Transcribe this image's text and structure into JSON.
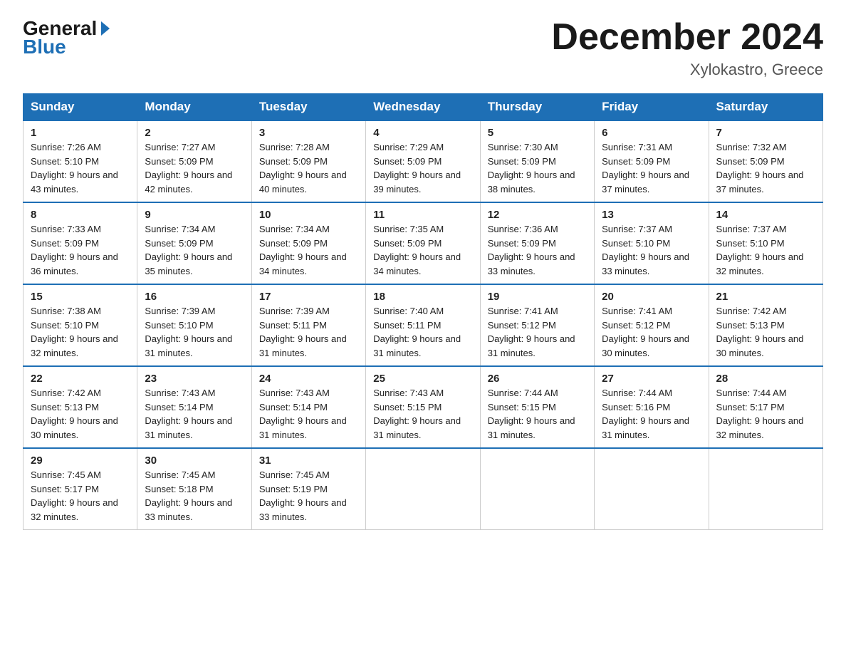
{
  "header": {
    "logo_general": "General",
    "logo_blue": "Blue",
    "month_title": "December 2024",
    "location": "Xylokastro, Greece"
  },
  "columns": [
    "Sunday",
    "Monday",
    "Tuesday",
    "Wednesday",
    "Thursday",
    "Friday",
    "Saturday"
  ],
  "weeks": [
    [
      {
        "day": "1",
        "sunrise": "7:26 AM",
        "sunset": "5:10 PM",
        "daylight": "9 hours and 43 minutes."
      },
      {
        "day": "2",
        "sunrise": "7:27 AM",
        "sunset": "5:09 PM",
        "daylight": "9 hours and 42 minutes."
      },
      {
        "day": "3",
        "sunrise": "7:28 AM",
        "sunset": "5:09 PM",
        "daylight": "9 hours and 40 minutes."
      },
      {
        "day": "4",
        "sunrise": "7:29 AM",
        "sunset": "5:09 PM",
        "daylight": "9 hours and 39 minutes."
      },
      {
        "day": "5",
        "sunrise": "7:30 AM",
        "sunset": "5:09 PM",
        "daylight": "9 hours and 38 minutes."
      },
      {
        "day": "6",
        "sunrise": "7:31 AM",
        "sunset": "5:09 PM",
        "daylight": "9 hours and 37 minutes."
      },
      {
        "day": "7",
        "sunrise": "7:32 AM",
        "sunset": "5:09 PM",
        "daylight": "9 hours and 37 minutes."
      }
    ],
    [
      {
        "day": "8",
        "sunrise": "7:33 AM",
        "sunset": "5:09 PM",
        "daylight": "9 hours and 36 minutes."
      },
      {
        "day": "9",
        "sunrise": "7:34 AM",
        "sunset": "5:09 PM",
        "daylight": "9 hours and 35 minutes."
      },
      {
        "day": "10",
        "sunrise": "7:34 AM",
        "sunset": "5:09 PM",
        "daylight": "9 hours and 34 minutes."
      },
      {
        "day": "11",
        "sunrise": "7:35 AM",
        "sunset": "5:09 PM",
        "daylight": "9 hours and 34 minutes."
      },
      {
        "day": "12",
        "sunrise": "7:36 AM",
        "sunset": "5:09 PM",
        "daylight": "9 hours and 33 minutes."
      },
      {
        "day": "13",
        "sunrise": "7:37 AM",
        "sunset": "5:10 PM",
        "daylight": "9 hours and 33 minutes."
      },
      {
        "day": "14",
        "sunrise": "7:37 AM",
        "sunset": "5:10 PM",
        "daylight": "9 hours and 32 minutes."
      }
    ],
    [
      {
        "day": "15",
        "sunrise": "7:38 AM",
        "sunset": "5:10 PM",
        "daylight": "9 hours and 32 minutes."
      },
      {
        "day": "16",
        "sunrise": "7:39 AM",
        "sunset": "5:10 PM",
        "daylight": "9 hours and 31 minutes."
      },
      {
        "day": "17",
        "sunrise": "7:39 AM",
        "sunset": "5:11 PM",
        "daylight": "9 hours and 31 minutes."
      },
      {
        "day": "18",
        "sunrise": "7:40 AM",
        "sunset": "5:11 PM",
        "daylight": "9 hours and 31 minutes."
      },
      {
        "day": "19",
        "sunrise": "7:41 AM",
        "sunset": "5:12 PM",
        "daylight": "9 hours and 31 minutes."
      },
      {
        "day": "20",
        "sunrise": "7:41 AM",
        "sunset": "5:12 PM",
        "daylight": "9 hours and 30 minutes."
      },
      {
        "day": "21",
        "sunrise": "7:42 AM",
        "sunset": "5:13 PM",
        "daylight": "9 hours and 30 minutes."
      }
    ],
    [
      {
        "day": "22",
        "sunrise": "7:42 AM",
        "sunset": "5:13 PM",
        "daylight": "9 hours and 30 minutes."
      },
      {
        "day": "23",
        "sunrise": "7:43 AM",
        "sunset": "5:14 PM",
        "daylight": "9 hours and 31 minutes."
      },
      {
        "day": "24",
        "sunrise": "7:43 AM",
        "sunset": "5:14 PM",
        "daylight": "9 hours and 31 minutes."
      },
      {
        "day": "25",
        "sunrise": "7:43 AM",
        "sunset": "5:15 PM",
        "daylight": "9 hours and 31 minutes."
      },
      {
        "day": "26",
        "sunrise": "7:44 AM",
        "sunset": "5:15 PM",
        "daylight": "9 hours and 31 minutes."
      },
      {
        "day": "27",
        "sunrise": "7:44 AM",
        "sunset": "5:16 PM",
        "daylight": "9 hours and 31 minutes."
      },
      {
        "day": "28",
        "sunrise": "7:44 AM",
        "sunset": "5:17 PM",
        "daylight": "9 hours and 32 minutes."
      }
    ],
    [
      {
        "day": "29",
        "sunrise": "7:45 AM",
        "sunset": "5:17 PM",
        "daylight": "9 hours and 32 minutes."
      },
      {
        "day": "30",
        "sunrise": "7:45 AM",
        "sunset": "5:18 PM",
        "daylight": "9 hours and 33 minutes."
      },
      {
        "day": "31",
        "sunrise": "7:45 AM",
        "sunset": "5:19 PM",
        "daylight": "9 hours and 33 minutes."
      },
      null,
      null,
      null,
      null
    ]
  ]
}
